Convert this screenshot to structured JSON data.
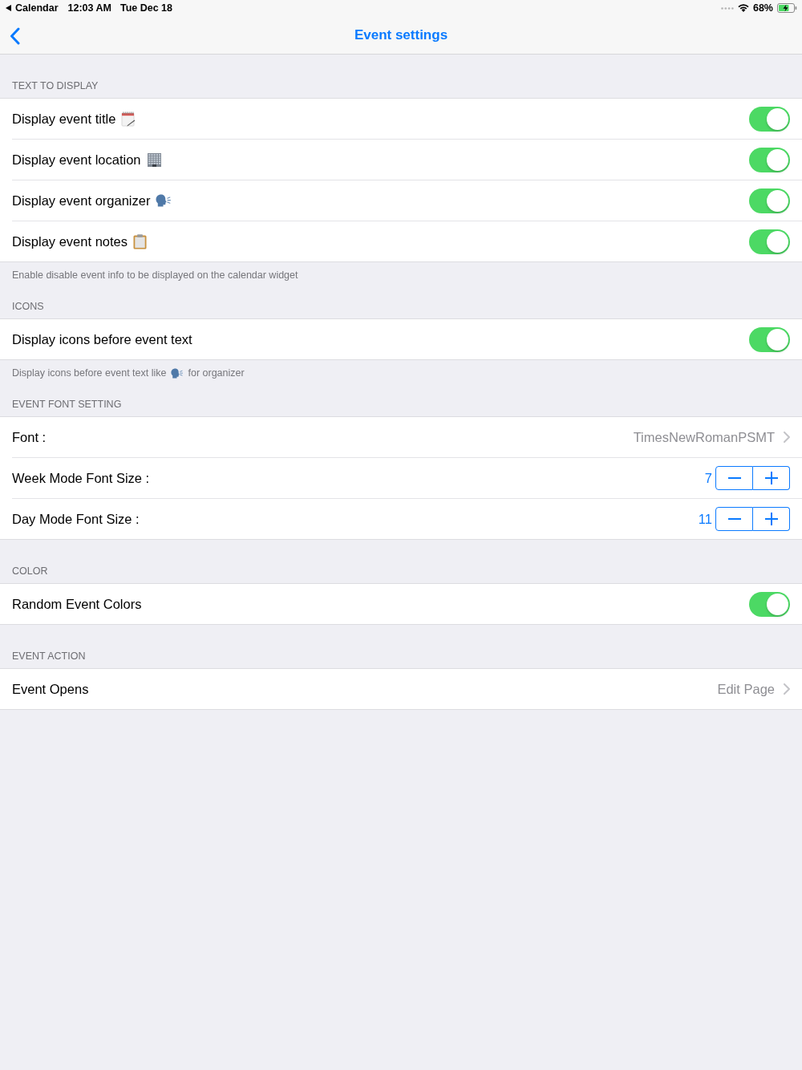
{
  "status_bar": {
    "back_app": "Calendar",
    "time": "12:03 AM",
    "date": "Tue Dec 18",
    "battery": "68%"
  },
  "nav_bar": {
    "title": "Event settings"
  },
  "sections": [
    {
      "header": "TEXT TO DISPLAY",
      "rows": [
        {
          "kind": "toggle",
          "label": "Display event title",
          "icon": true,
          "on": true
        },
        {
          "kind": "toggle",
          "label": "Display event location",
          "icon": true,
          "on": true
        },
        {
          "kind": "toggle",
          "label": "Display event organizer",
          "icon": true,
          "on": true
        },
        {
          "kind": "toggle",
          "label": "Display event notes",
          "icon": true,
          "on": true
        }
      ],
      "footer": [
        "Enable disable event info to be displayed on the calendar widget"
      ]
    },
    {
      "header": "ICONS",
      "rows": [
        {
          "kind": "toggle",
          "label": "Display icons before event text",
          "on": true
        }
      ],
      "footer": [
        "Display icons before event text like",
        "for organizer"
      ]
    },
    {
      "header": "EVENT FONT SETTING",
      "rows": [
        {
          "kind": "disclosure",
          "label": "Font :",
          "value": "TimesNewRomanPSMT"
        },
        {
          "kind": "stepper",
          "label": "Week Mode Font Size :",
          "value": "7"
        },
        {
          "kind": "stepper",
          "label": "Day Mode Font Size :",
          "value": "11"
        }
      ]
    },
    {
      "header": "COLOR",
      "rows": [
        {
          "kind": "toggle",
          "label": "Random Event Colors",
          "on": true
        }
      ]
    },
    {
      "header": "EVENT ACTION",
      "rows": [
        {
          "kind": "disclosure",
          "label": "Event Opens",
          "value": "Edit Page"
        }
      ]
    }
  ]
}
